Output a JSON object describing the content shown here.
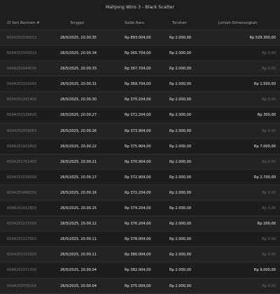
{
  "window": {
    "title": "Mahjong Wins 3 - Black Scatter"
  },
  "table": {
    "headers": {
      "id": "ID Seri Bermain #",
      "date": "Tanggal",
      "saldo": "Saldo Baru",
      "taruhan": "Taruhan",
      "win": "Jumlah Dimenangkan"
    },
    "rows": [
      {
        "id": "6094252500013",
        "date": "26/5/2025, 20.00.35",
        "saldo": "Rp 893.004,00",
        "taruhan": "Rp 2.000,00",
        "win": "Rp 529.300,00",
        "positive": true
      },
      {
        "id": "6094252500013",
        "date": "26/5/2025, 20.00.34",
        "saldo": "Rp 365.704,00",
        "taruhan": "Rp 2.000,00",
        "win": "Rp 0,00",
        "positive": false
      },
      {
        "id": "6094252444030",
        "date": "26/5/2025, 20.00.33",
        "saldo": "Rp 367.704,00",
        "taruhan": "Rp 2.000,00",
        "win": "Rp 0,00",
        "positive": false
      },
      {
        "id": "6094252315093",
        "date": "26/5/2025, 20.00.31",
        "saldo": "Rp 369.704,00",
        "taruhan": "Rp 2.000,00",
        "win": "Rp 1.500,00",
        "positive": true
      },
      {
        "id": "6094252261403",
        "date": "26/5/2025, 20.00.30",
        "saldo": "Rp 370.204,00",
        "taruhan": "Rp 2.000,00",
        "win": "Rp 0,00",
        "positive": false
      },
      {
        "id": "6094252126603",
        "date": "26/5/2025, 20.00.27",
        "saldo": "Rp 372.204,00",
        "taruhan": "Rp 2.000,00",
        "win": "Rp 300,00",
        "positive": true
      },
      {
        "id": "6094252059063",
        "date": "26/5/2025, 20.00.26",
        "saldo": "Rp 373.904,00",
        "taruhan": "Rp 2.000,00",
        "win": "Rp 0,00",
        "positive": false
      },
      {
        "id": "6094251916403",
        "date": "26/5/2025, 20.00.22",
        "saldo": "Rp 375.904,00",
        "taruhan": "Rp 2.000,00",
        "win": "Rp 7.000,00",
        "positive": true
      },
      {
        "id": "6094251761403",
        "date": "26/5/2025, 20.00.21",
        "saldo": "Rp 370.904,00",
        "taruhan": "Rp 2.000,00",
        "win": "Rp 0,00",
        "positive": false
      },
      {
        "id": "6094251535093",
        "date": "26/5/2025, 20.00.17",
        "saldo": "Rp 372.904,00",
        "taruhan": "Rp 2.000,00",
        "win": "Rp 2.700,00",
        "positive": true
      },
      {
        "id": "6094251468303",
        "date": "26/5/2025, 20.00.16",
        "saldo": "Rp 372.204,00",
        "taruhan": "Rp 2.000,00",
        "win": "Rp 0,00",
        "positive": false
      },
      {
        "id": "6094251412803",
        "date": "26/5/2025, 20.00.15",
        "saldo": "Rp 374.204,00",
        "taruhan": "Rp 2.000,00",
        "win": "Rp 0,00",
        "positive": false
      },
      {
        "id": "6094251273093",
        "date": "26/5/2025, 20.00.12",
        "saldo": "Rp 376.204,00",
        "taruhan": "Rp 2.000,00",
        "win": "Rp 200,00",
        "positive": true
      },
      {
        "id": "6094251217903",
        "date": "26/5/2025, 20.00.11",
        "saldo": "Rp 378.004,00",
        "taruhan": "Rp 2.000,00",
        "win": "Rp 0,00",
        "positive": false
      },
      {
        "id": "6094251152903",
        "date": "26/5/2025, 20.00.11",
        "saldo": "Rp 380.004,00",
        "taruhan": "Rp 2.000,00",
        "win": "Rp 0,00",
        "positive": false
      },
      {
        "id": "6094251071303",
        "date": "26/5/2025, 20.00.04",
        "saldo": "Rp 382.004,00",
        "taruhan": "Rp 2.000,00",
        "win": "Rp 9.000,00",
        "positive": true
      },
      {
        "id": "6094250709303",
        "date": "26/5/2025, 20.00.04",
        "saldo": "Rp 375.004,00",
        "taruhan": "Rp 2.000,00",
        "win": "Rp 0,00",
        "positive": false
      }
    ]
  }
}
